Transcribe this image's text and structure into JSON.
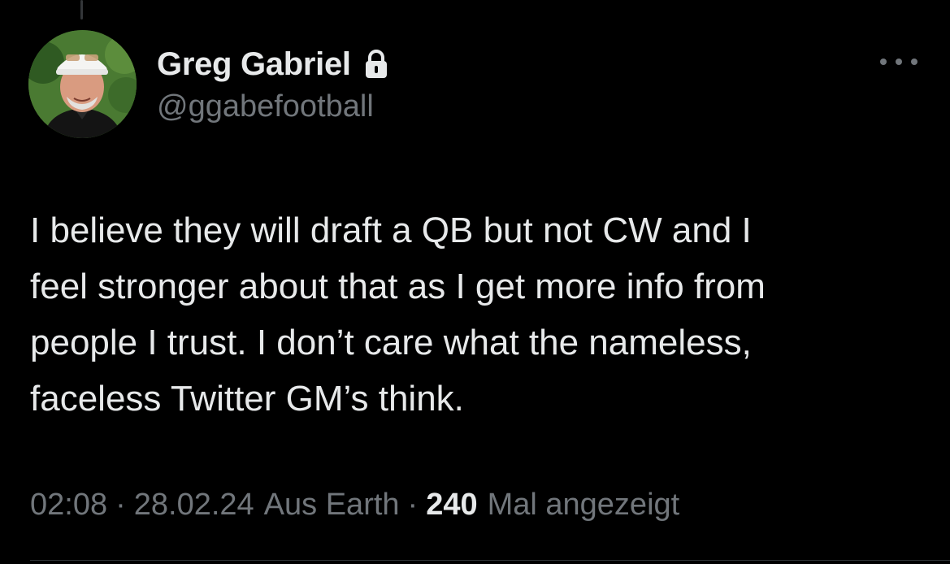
{
  "tweet": {
    "author": {
      "display_name": "Greg Gabriel",
      "handle": "@ggabefootball",
      "protected_icon": "lock-icon",
      "avatar": "profile-photo"
    },
    "more_icon": "more-horizontal-icon",
    "text_lines": [
      "I believe they will draft a QB but not CW and I",
      "feel stronger about that as I get more info from",
      "people I trust. I don’t care what the nameless,",
      "faceless Twitter GM’s think."
    ],
    "meta": {
      "time": "02:08",
      "separator": "·",
      "date": "28.02.24",
      "location": "Aus Earth",
      "views_count": "240",
      "views_label": "Mal angezeigt"
    }
  },
  "colors": {
    "background": "#000000",
    "primary_text": "#e7e9ea",
    "secondary_text": "#71767b",
    "divider": "#2f3336"
  }
}
